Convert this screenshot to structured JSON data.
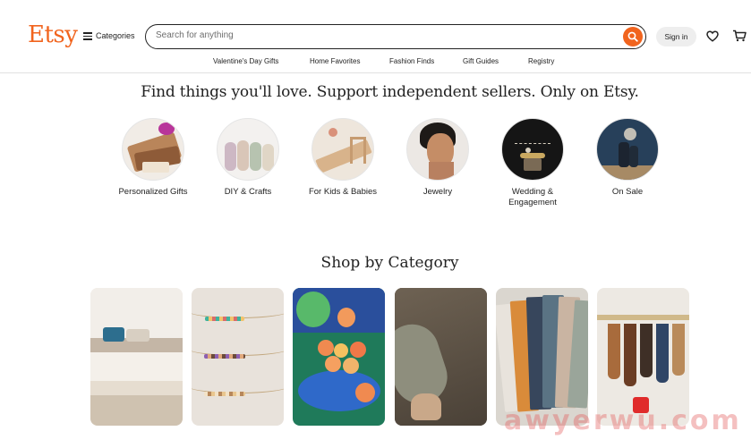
{
  "header": {
    "logo": "Etsy",
    "categories_label": "Categories",
    "search_placeholder": "Search for anything",
    "signin_label": "Sign in"
  },
  "nav": {
    "items": [
      "Valentine's Day Gifts",
      "Home Favorites",
      "Fashion Finds",
      "Gift Guides",
      "Registry"
    ]
  },
  "hero": {
    "title": "Find things you'll love. Support independent sellers. Only on Etsy.",
    "categories": [
      {
        "label": "Personalized Gifts"
      },
      {
        "label": "DIY & Crafts"
      },
      {
        "label": "For Kids & Babies"
      },
      {
        "label": "Jewelry"
      },
      {
        "label": "Wedding & Engagement"
      },
      {
        "label": "On Sale"
      }
    ]
  },
  "shop_by_category": {
    "title": "Shop by Category"
  },
  "watermark": "awyerwu.com",
  "colors": {
    "brand": "#f1641e",
    "text": "#222222"
  }
}
